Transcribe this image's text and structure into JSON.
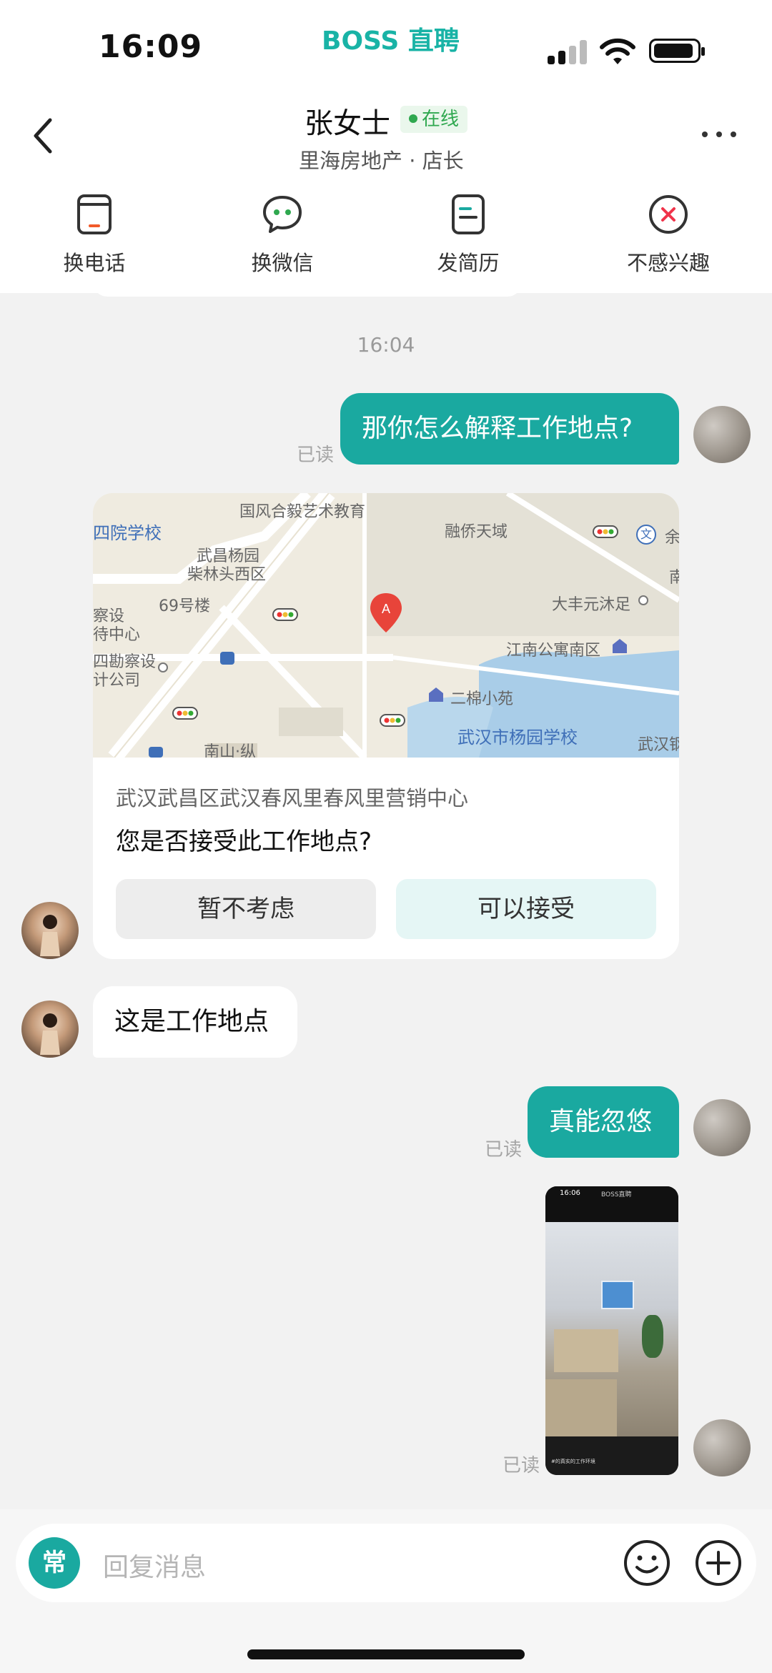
{
  "status_bar": {
    "time": "16:09",
    "brand": "BOSS 直聘"
  },
  "header": {
    "name": "张女士",
    "online": "在线",
    "subtitle": "里海房地产 · 店长",
    "actions": [
      {
        "label": "换电话",
        "icon": "phone-icon"
      },
      {
        "label": "换微信",
        "icon": "wechat-icon"
      },
      {
        "label": "发简历",
        "icon": "resume-icon"
      },
      {
        "label": "不感兴趣",
        "icon": "close-icon"
      }
    ]
  },
  "chat": {
    "timestamp": "16:04",
    "messages": [
      {
        "from": "me",
        "text": "那你怎么解释工作地点?",
        "read": "已读"
      },
      {
        "from": "other",
        "type": "location",
        "address": "武汉武昌区武汉春风里春风里营销中心",
        "question": "您是否接受此工作地点?",
        "decline": "暂不考虑",
        "accept": "可以接受",
        "map_labels": [
          "国风合毅艺术教育",
          "融侨天域",
          "四院学校",
          "武昌杨园",
          "柴林头西区",
          "69号楼",
          "察设",
          "待中心",
          "四勘察设",
          "计公司",
          "大丰元沐足",
          "江南公寓南区",
          "二棉小苑",
          "武汉市杨园学校",
          "南山·纵",
          "武汉钢",
          "余",
          "南",
          "文"
        ],
        "pin_label": "A"
      },
      {
        "from": "other",
        "text": "这是工作地点"
      },
      {
        "from": "me",
        "text": "真能忽悠",
        "read": "已读"
      },
      {
        "from": "me",
        "type": "image",
        "read": "已读",
        "image_texts": {
          "time": "16:06",
          "brand": "BOSS直聘",
          "caption": "#的真实的工作环境"
        }
      }
    ]
  },
  "input": {
    "quick_label": "常",
    "placeholder": "回复消息"
  },
  "colors": {
    "accent": "#1aa9a0",
    "online": "#2fa84f"
  }
}
